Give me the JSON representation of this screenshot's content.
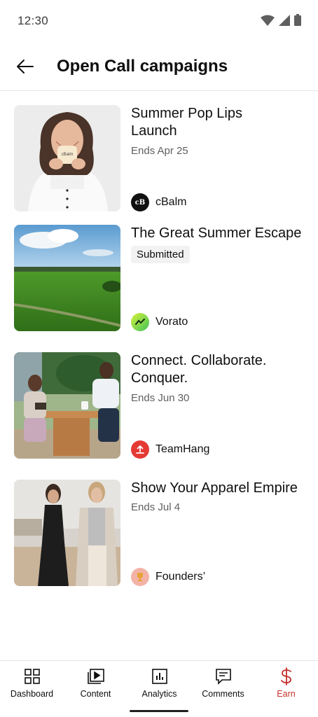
{
  "status": {
    "time": "12:30"
  },
  "header": {
    "title": "Open Call campaigns"
  },
  "campaigns": [
    {
      "title": "Summer Pop Lips Launch",
      "subtitle": "Ends Apr 25",
      "brand": "cBalm"
    },
    {
      "title": "The Great Summer Escape",
      "badge": "Submitted",
      "brand": "Vorato"
    },
    {
      "title": "Connect. Collaborate. Conquer.",
      "subtitle": "Ends Jun 30",
      "brand": "TeamHang"
    },
    {
      "title": "Show Your Apparel Empire",
      "subtitle": "Ends Jul 4",
      "brand": "Founders’"
    }
  ],
  "brand_logo_text": {
    "cbalm": "cB"
  },
  "nav": [
    {
      "label": "Dashboard",
      "icon": "dashboard-icon"
    },
    {
      "label": "Content",
      "icon": "content-icon"
    },
    {
      "label": "Analytics",
      "icon": "analytics-icon"
    },
    {
      "label": "Comments",
      "icon": "comments-icon"
    },
    {
      "label": "Earn",
      "icon": "dollar-icon",
      "active": true
    }
  ],
  "colors": {
    "accent": "#c4302b",
    "text": "#0f0f0f",
    "secondary": "#606060",
    "divider": "#e5e5e5"
  }
}
